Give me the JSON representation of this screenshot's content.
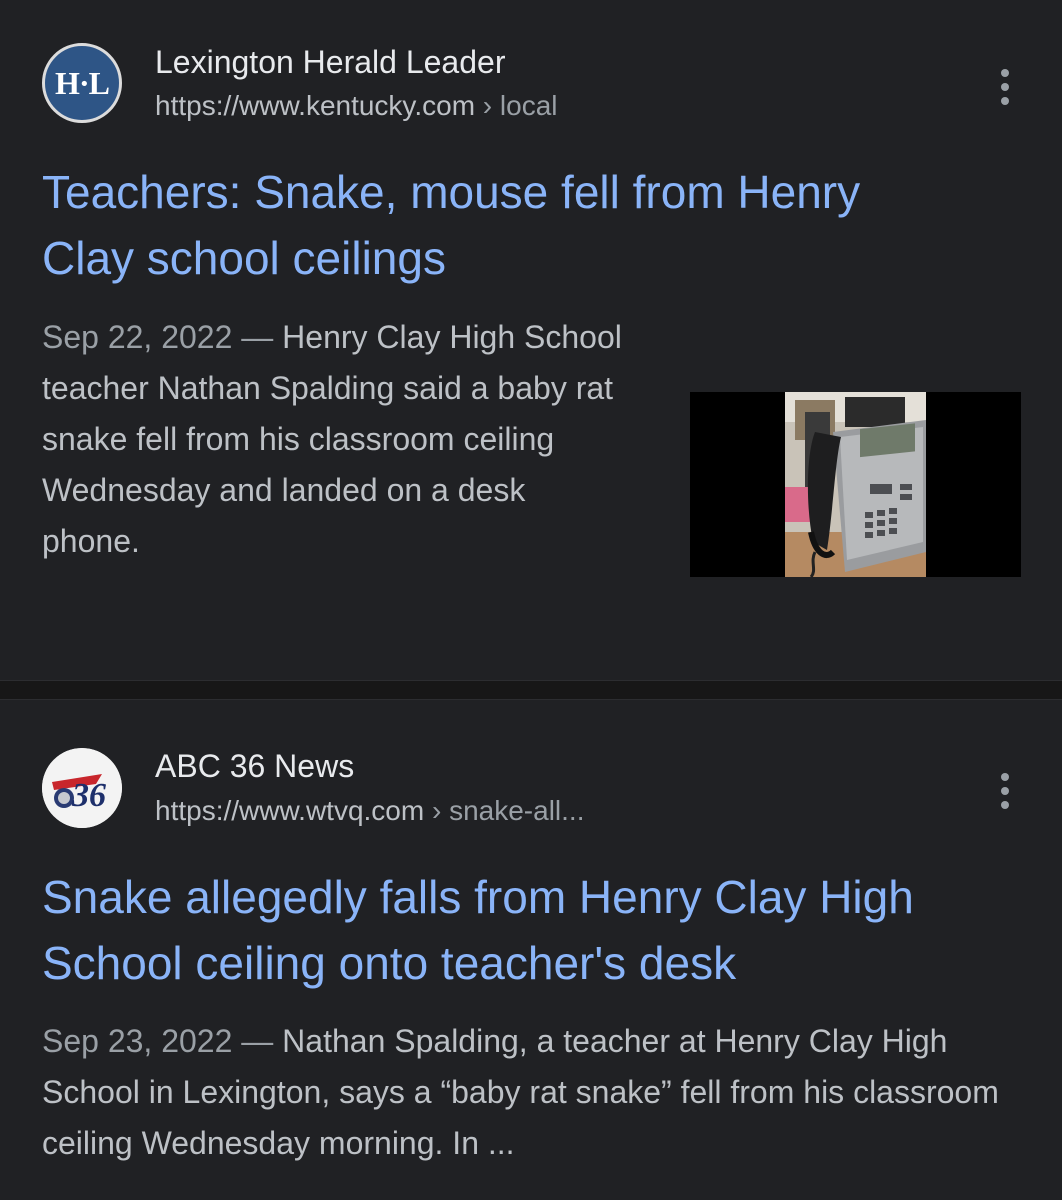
{
  "results": [
    {
      "site_name": "Lexington Herald Leader",
      "url_domain": "https://www.kentucky.com",
      "url_separator": " › ",
      "url_path": "local",
      "favicon_text": "H·L",
      "title": "Teachers: Snake, mouse fell from Henry Clay school ceilings",
      "date": "Sep 22, 2022",
      "date_separator": " — ",
      "snippet": "Henry Clay High School teacher Nathan Spalding said a baby rat snake fell from his classroom ceiling Wednesday and landed on a desk phone.",
      "thumbnail_icon": "desk-phone-photo"
    },
    {
      "site_name": "ABC 36 News",
      "url_domain": "https://www.wtvq.com",
      "url_separator": " › ",
      "url_path": "snake-all...",
      "favicon_text": "36",
      "title": "Snake allegedly falls from Henry Clay High School ceiling onto teacher's desk",
      "date": "Sep 23, 2022",
      "date_separator": " — ",
      "snippet": "Nathan Spalding, a teacher at Henry Clay High School in Lexington, says a “baby rat snake” fell from his classroom ceiling Wednesday morning. In ..."
    }
  ],
  "colors": {
    "background": "#202124",
    "title_link": "#8ab4f8",
    "site_name": "#e8eaed",
    "snippet": "#bdc1c6",
    "muted": "#9aa0a6"
  }
}
